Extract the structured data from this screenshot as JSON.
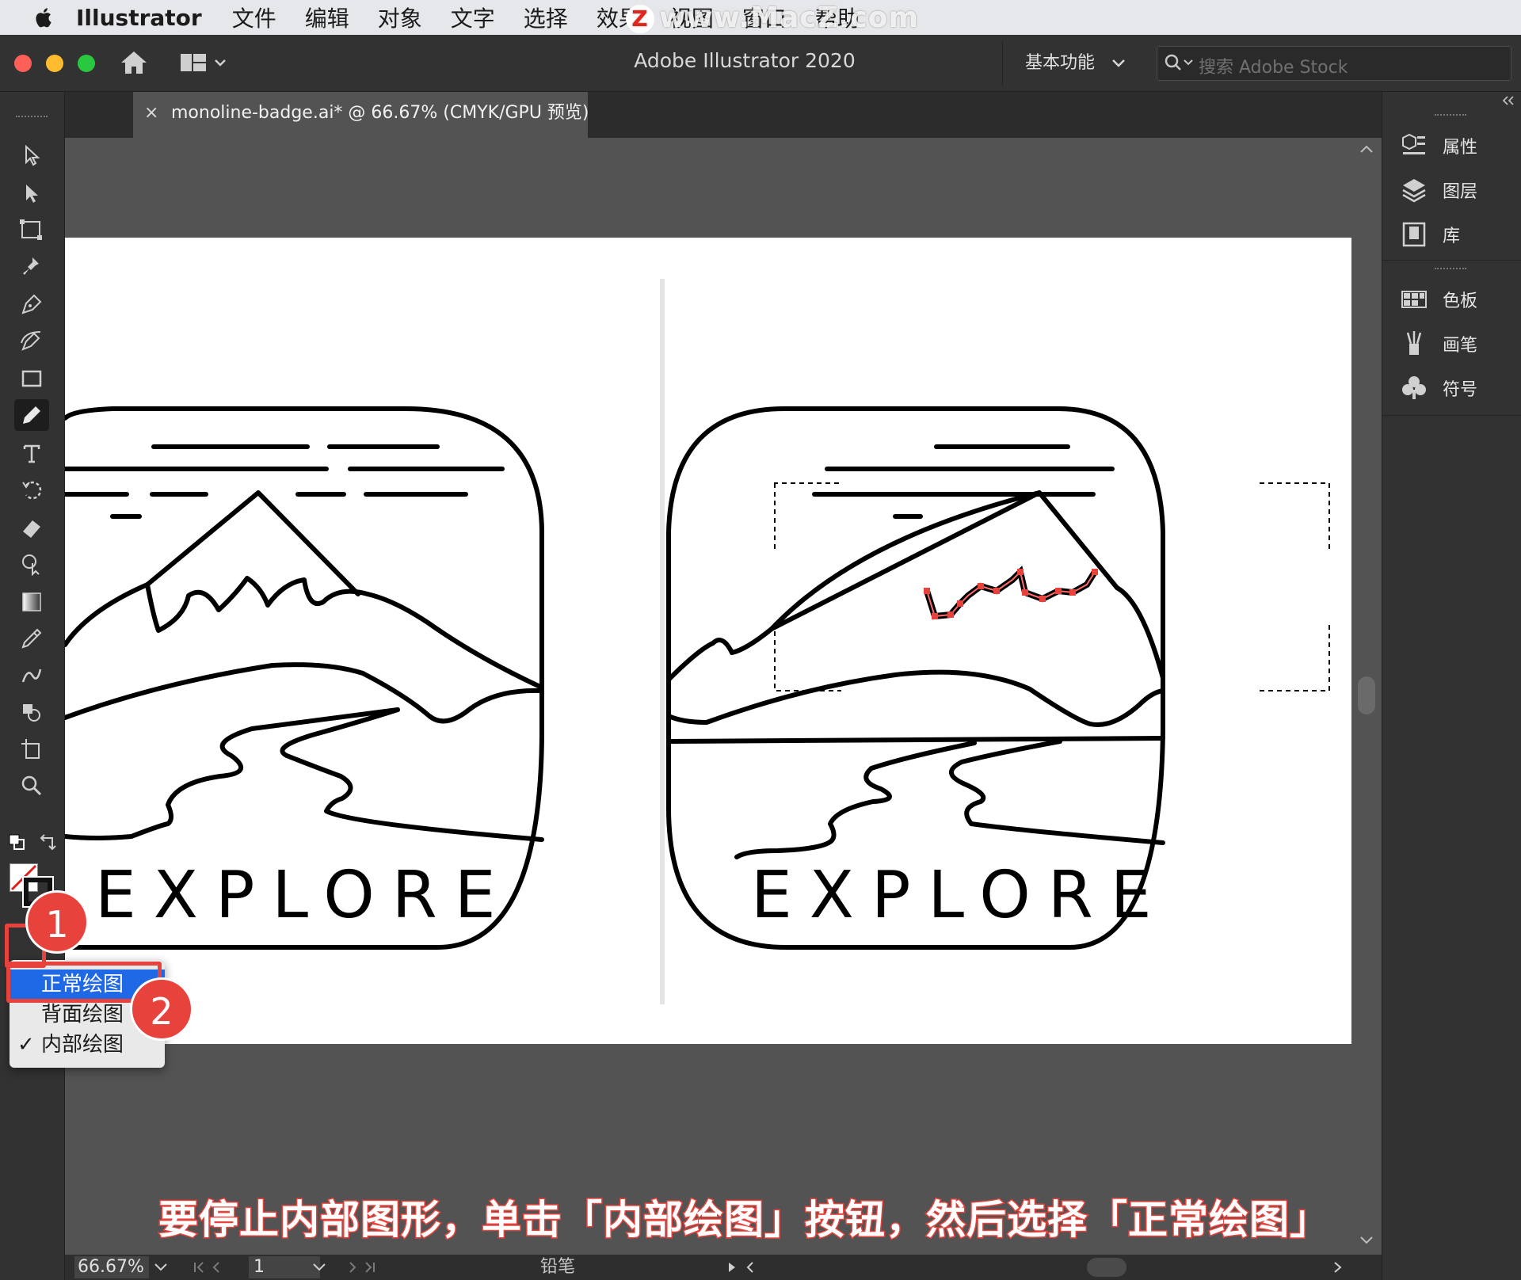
{
  "menubar": {
    "app_name": "Illustrator",
    "items": [
      "文件",
      "编辑",
      "对象",
      "文字",
      "选择",
      "效果",
      "视图",
      "窗口",
      "帮助"
    ]
  },
  "watermark": {
    "text": "www.MacZ.com",
    "logo_letter": "Z"
  },
  "titlebar": {
    "title": "Adobe Illustrator 2020",
    "workspace": "基本功能",
    "search_placeholder": "搜索 Adobe Stock"
  },
  "document": {
    "tab_label": "monoline-badge.ai* @ 66.67% (CMYK/GPU 预览)",
    "close_glyph": "×"
  },
  "artwork": {
    "left_badge_text": "EXPLORE",
    "right_badge_text": "EXPLORE"
  },
  "right_panel": {
    "items": [
      {
        "label": "属性",
        "icon": "properties-icon"
      },
      {
        "label": "图层",
        "icon": "layers-icon"
      },
      {
        "label": "库",
        "icon": "libraries-icon"
      },
      {
        "label": "色板",
        "icon": "swatches-icon"
      },
      {
        "label": "画笔",
        "icon": "brushes-icon"
      },
      {
        "label": "符号",
        "icon": "symbols-icon"
      }
    ]
  },
  "drawing_mode_menu": {
    "options": [
      "正常绘图",
      "背面绘图",
      "内部绘图"
    ],
    "highlighted": "正常绘图",
    "checked": "内部绘图",
    "check_glyph": "✓"
  },
  "annotations": {
    "step1": "1",
    "step2": "2",
    "caption": "要停止内部图形，单击「内部绘图」按钮，然后选择「正常绘图」",
    "accent_color": "#e8423c"
  },
  "statusbar": {
    "zoom": "66.67%",
    "artboard_number": "1",
    "current_tool": "铅笔"
  },
  "colors": {
    "ui_dark": "#323232",
    "canvas": "#535353",
    "menu_highlight": "#1f68e6"
  }
}
